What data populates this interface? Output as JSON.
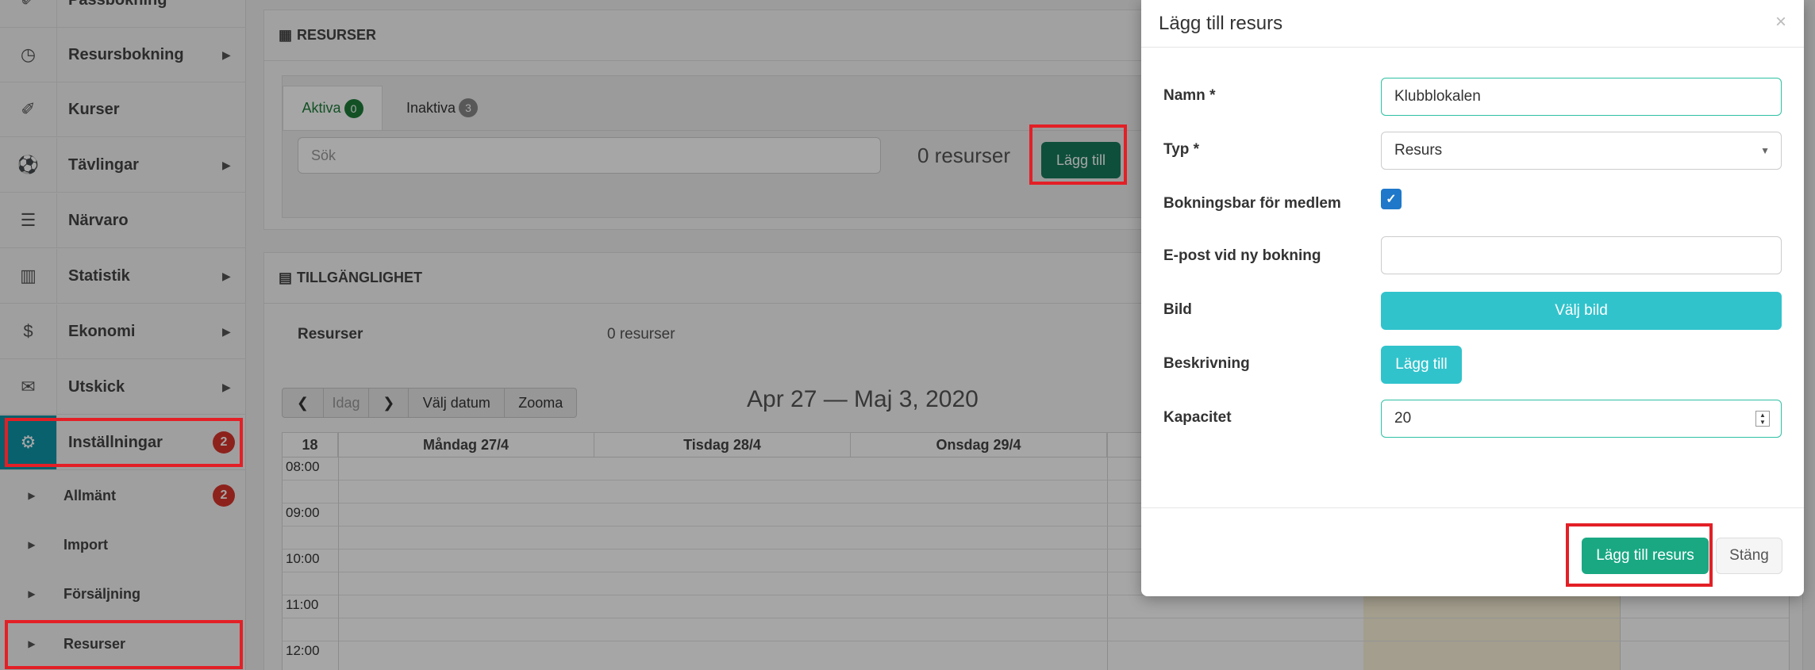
{
  "sidebar": {
    "items": [
      {
        "label": "Passbokning",
        "icon": "ticket-icon",
        "glyph": "✐"
      },
      {
        "label": "Resursbokning",
        "icon": "clock-icon",
        "glyph": "◷"
      },
      {
        "label": "Kurser",
        "icon": "ticket-icon",
        "glyph": "✐"
      },
      {
        "label": "Tävlingar",
        "icon": "soccer-ball-icon",
        "glyph": "⚽"
      },
      {
        "label": "Närvaro",
        "icon": "list-icon",
        "glyph": "☰"
      },
      {
        "label": "Statistik",
        "icon": "bar-chart-icon",
        "glyph": "▥"
      },
      {
        "label": "Ekonomi",
        "icon": "dollar-icon",
        "glyph": "$"
      },
      {
        "label": "Utskick",
        "icon": "envelope-icon",
        "glyph": "✉"
      },
      {
        "label": "Inställningar",
        "icon": "gear-icon",
        "glyph": "⚙",
        "badge": "2"
      }
    ],
    "subitems": [
      {
        "label": "Allmänt",
        "badge": "2"
      },
      {
        "label": "Import"
      },
      {
        "label": "Försäljning"
      },
      {
        "label": "Resurser"
      }
    ]
  },
  "resurser_panel": {
    "title": "RESURSER",
    "tabs": [
      {
        "label": "Aktiva",
        "count": "0"
      },
      {
        "label": "Inaktiva",
        "count": "3"
      }
    ],
    "search_placeholder": "Sök",
    "count_text": "0 resurser",
    "add_button": "Lägg till"
  },
  "tillganglighet_panel": {
    "title": "TILLGÄNGLIGHET",
    "resources_label": "Resurser",
    "resources_value": "0 resurser"
  },
  "calendar": {
    "toolbar": {
      "prev": "❮",
      "today": "Idag",
      "next": "❯",
      "pick_date": "Välj datum",
      "zoom": "Zooma"
    },
    "title": "Apr 27 — Maj 3, 2020",
    "week": "18",
    "days": [
      "Måndag 27/4",
      "Tisdag 28/4",
      "Onsdag 29/4"
    ],
    "times": [
      "08:00",
      "09:00",
      "10:00",
      "11:00",
      "12:00"
    ]
  },
  "modal": {
    "title": "Lägg till resurs",
    "close": "×",
    "fields": {
      "name_label": "Namn *",
      "name_value": "Klubblokalen",
      "type_label": "Typ *",
      "type_value": "Resurs",
      "bookable_label": "Bokningsbar för medlem",
      "bookable_checked": "✓",
      "email_label": "E-post vid ny bokning",
      "email_value": "",
      "image_label": "Bild",
      "image_button": "Välj bild",
      "description_label": "Beskrivning",
      "description_button": "Lägg till",
      "capacity_label": "Kapacitet",
      "capacity_value": "20"
    },
    "submit": "Lägg till resurs",
    "cancel": "Stäng"
  },
  "colors": {
    "accent": "#0f96a8",
    "green": "#167a5b",
    "primary": "#1aa883",
    "cyan": "#31c3cc",
    "highlight": "#e31f26"
  }
}
